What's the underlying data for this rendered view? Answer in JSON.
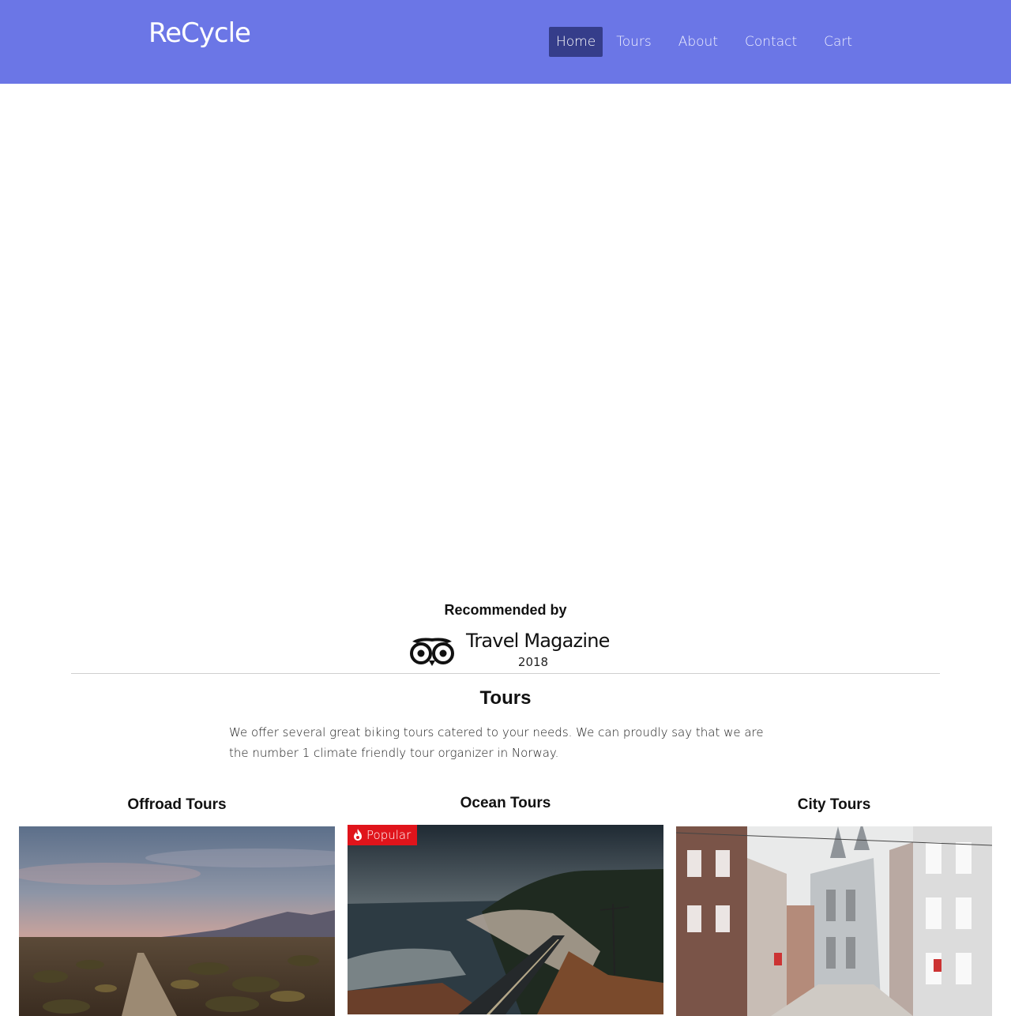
{
  "header": {
    "brand": "ReCycle",
    "nav": [
      {
        "label": "Home",
        "active": true
      },
      {
        "label": "Tours"
      },
      {
        "label": "About"
      },
      {
        "label": "Contact"
      },
      {
        "label": "Cart"
      }
    ]
  },
  "recommended": {
    "title": "Recommended by",
    "logo_icon": "owl-eyes-icon",
    "name": "Travel Magazine",
    "year": "2018"
  },
  "tours": {
    "title": "Tours",
    "description": "We offer several great biking tours catered to your needs. We can proudly say that we are the number 1 climate friendly tour organizer in Norway."
  },
  "cards": [
    {
      "title": "Offroad Tours",
      "image": "desert-dirt-road-photo"
    },
    {
      "title": "Ocean Tours",
      "image": "coastal-road-photo",
      "badge": "Popular",
      "badge_icon": "flame-icon",
      "badge_color": "#e0141b"
    },
    {
      "title": "City Tours",
      "image": "city-street-photo"
    }
  ],
  "colors": {
    "header": "#6b76e6",
    "nav_active": "#353d8a"
  }
}
